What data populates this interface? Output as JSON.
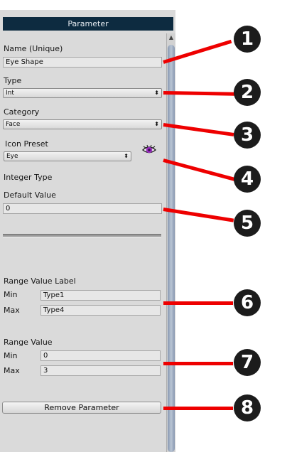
{
  "panel": {
    "header": "Parameter",
    "name_label": "Name (Unique)",
    "name_value": "Eye Shape",
    "type_label": "Type",
    "type_value": "Int",
    "category_label": "Category",
    "category_value": "Face",
    "icon_preset_label": "Icon Preset",
    "icon_preset_value": "Eye",
    "icon_preset_icon": "eye-icon",
    "integer_type_label": "Integer Type",
    "default_value_label": "Default Value",
    "default_value": "0",
    "range_label_heading": "Range Value Label",
    "range_label_min_label": "Min",
    "range_label_min_value": "Type1",
    "range_label_max_label": "Max",
    "range_label_max_value": "Type4",
    "range_value_heading": "Range Value",
    "range_min_label": "Min",
    "range_min_value": "0",
    "range_max_label": "Max",
    "range_max_value": "3",
    "remove_button": "Remove Parameter",
    "dropdown_arrow": "⬍",
    "scroll_up": "▲"
  },
  "callouts": [
    "1",
    "2",
    "3",
    "4",
    "5",
    "6",
    "7",
    "8"
  ],
  "colors": {
    "callout_line": "#ee0000",
    "callout_circle": "#1c1c1c",
    "header": "#0d2b40"
  }
}
